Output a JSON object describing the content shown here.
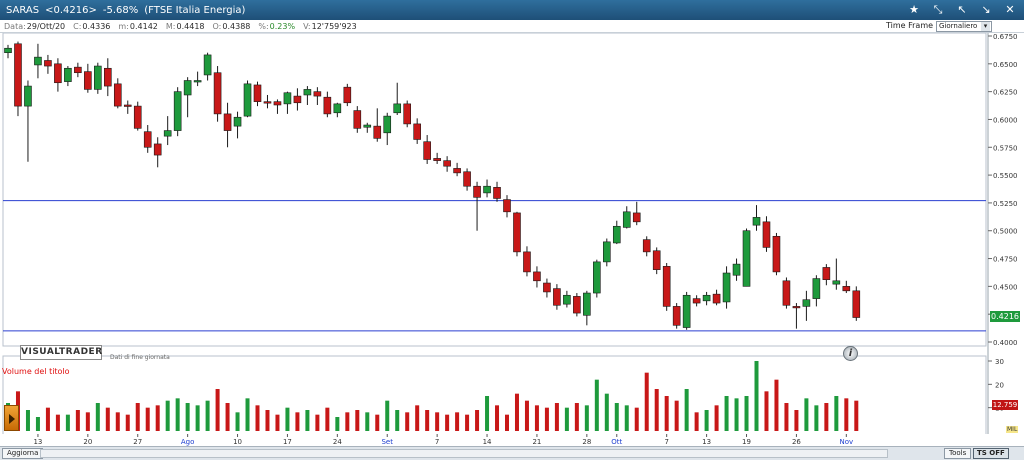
{
  "window": {
    "symbol": "SARAS",
    "price_change": "<0.4216>",
    "change_pct": "-5.68%",
    "index_name": "(FTSE Italia Energia)"
  },
  "infobar": {
    "date_label": "Data:",
    "date_value": "29/Ott/20",
    "close_label": "C:",
    "close_value": "0.4336",
    "min_label": "m:",
    "min_value": "0.4142",
    "max_label": "M:",
    "max_value": "0.4418",
    "open_label": "O:",
    "open_value": "0.4388",
    "pct_label": "%:",
    "pct_value": "0.23%",
    "volume_label": "V:",
    "volume_value": "12'759'923"
  },
  "timeframe": {
    "label": "Time Frame",
    "selected": "Giornaliero"
  },
  "logo": {
    "text": "VISUALTRADER",
    "note": "Dati di fine giornata"
  },
  "volume_panel": {
    "title": "Volume del titolo",
    "unit": "MIL",
    "badge": "12.759"
  },
  "last_price_badge": "0.4216",
  "bottom": {
    "refresh_label": "Aggiorna",
    "tools_label": "Tools",
    "tsoff_label": "TS OFF"
  },
  "colors": {
    "up": "#1e9a3c",
    "down": "#c81818",
    "hline": "#2a3fd0",
    "volume_up": "#1e9a3c",
    "volume_down": "#c81818"
  },
  "chart_data": {
    "type": "candlestick",
    "price_axis": {
      "min": 0.4,
      "max": 0.675,
      "ticks": [
        "0.6750",
        "0.6500",
        "0.6250",
        "0.6000",
        "0.5750",
        "0.5500",
        "0.5250",
        "0.5000",
        "0.4750",
        "0.4500",
        "0.4250",
        "0.4000"
      ]
    },
    "volume_axis": {
      "min": 0,
      "max": 30,
      "ticks": [
        "30",
        "20",
        "10"
      ]
    },
    "x_labels": [
      {
        "label": "13",
        "idx": 3
      },
      {
        "label": "20",
        "idx": 8
      },
      {
        "label": "27",
        "idx": 13
      },
      {
        "label": "Ago",
        "idx": 18,
        "month": true
      },
      {
        "label": "10",
        "idx": 23
      },
      {
        "label": "17",
        "idx": 28
      },
      {
        "label": "24",
        "idx": 33
      },
      {
        "label": "Set",
        "idx": 38,
        "month": true
      },
      {
        "label": "7",
        "idx": 43
      },
      {
        "label": "14",
        "idx": 48
      },
      {
        "label": "21",
        "idx": 53
      },
      {
        "label": "28",
        "idx": 58
      },
      {
        "label": "Ott",
        "idx": 61,
        "month": true
      },
      {
        "label": "7",
        "idx": 66
      },
      {
        "label": "13",
        "idx": 70
      },
      {
        "label": "19",
        "idx": 74
      },
      {
        "label": "26",
        "idx": 79
      },
      {
        "label": "Nov",
        "idx": 84,
        "month": true
      }
    ],
    "horizontal_lines": [
      0.527,
      0.41
    ],
    "candles": [
      {
        "o": 0.66,
        "h": 0.667,
        "l": 0.655,
        "c": 0.664,
        "v": 12
      },
      {
        "o": 0.668,
        "h": 0.67,
        "l": 0.603,
        "c": 0.612,
        "v": 17
      },
      {
        "o": 0.612,
        "h": 0.635,
        "l": 0.562,
        "c": 0.63,
        "v": 9
      },
      {
        "o": 0.649,
        "h": 0.668,
        "l": 0.637,
        "c": 0.656,
        "v": 6
      },
      {
        "o": 0.653,
        "h": 0.658,
        "l": 0.641,
        "c": 0.648,
        "v": 10
      },
      {
        "o": 0.65,
        "h": 0.655,
        "l": 0.625,
        "c": 0.633,
        "v": 7
      },
      {
        "o": 0.634,
        "h": 0.648,
        "l": 0.63,
        "c": 0.646,
        "v": 7
      },
      {
        "o": 0.647,
        "h": 0.651,
        "l": 0.638,
        "c": 0.642,
        "v": 9
      },
      {
        "o": 0.643,
        "h": 0.65,
        "l": 0.624,
        "c": 0.627,
        "v": 8
      },
      {
        "o": 0.627,
        "h": 0.651,
        "l": 0.623,
        "c": 0.648,
        "v": 12
      },
      {
        "o": 0.646,
        "h": 0.655,
        "l": 0.621,
        "c": 0.63,
        "v": 10
      },
      {
        "o": 0.632,
        "h": 0.637,
        "l": 0.61,
        "c": 0.612,
        "v": 8
      },
      {
        "o": 0.613,
        "h": 0.617,
        "l": 0.605,
        "c": 0.612,
        "v": 7
      },
      {
        "o": 0.612,
        "h": 0.616,
        "l": 0.59,
        "c": 0.592,
        "v": 12
      },
      {
        "o": 0.589,
        "h": 0.595,
        "l": 0.57,
        "c": 0.575,
        "v": 10
      },
      {
        "o": 0.578,
        "h": 0.584,
        "l": 0.557,
        "c": 0.568,
        "v": 11
      },
      {
        "o": 0.585,
        "h": 0.603,
        "l": 0.577,
        "c": 0.59,
        "v": 13
      },
      {
        "o": 0.59,
        "h": 0.629,
        "l": 0.585,
        "c": 0.625,
        "v": 14
      },
      {
        "o": 0.622,
        "h": 0.638,
        "l": 0.602,
        "c": 0.635,
        "v": 12
      },
      {
        "o": 0.634,
        "h": 0.643,
        "l": 0.63,
        "c": 0.635,
        "v": 11
      },
      {
        "o": 0.64,
        "h": 0.66,
        "l": 0.635,
        "c": 0.658,
        "v": 13
      },
      {
        "o": 0.642,
        "h": 0.648,
        "l": 0.598,
        "c": 0.605,
        "v": 18
      },
      {
        "o": 0.605,
        "h": 0.615,
        "l": 0.575,
        "c": 0.59,
        "v": 12
      },
      {
        "o": 0.594,
        "h": 0.607,
        "l": 0.583,
        "c": 0.602,
        "v": 8
      },
      {
        "o": 0.603,
        "h": 0.635,
        "l": 0.602,
        "c": 0.632,
        "v": 14
      },
      {
        "o": 0.631,
        "h": 0.634,
        "l": 0.612,
        "c": 0.616,
        "v": 11
      },
      {
        "o": 0.616,
        "h": 0.622,
        "l": 0.61,
        "c": 0.615,
        "v": 9
      },
      {
        "o": 0.616,
        "h": 0.618,
        "l": 0.605,
        "c": 0.613,
        "v": 7
      },
      {
        "o": 0.614,
        "h": 0.625,
        "l": 0.605,
        "c": 0.624,
        "v": 10
      },
      {
        "o": 0.621,
        "h": 0.628,
        "l": 0.608,
        "c": 0.615,
        "v": 8
      },
      {
        "o": 0.622,
        "h": 0.63,
        "l": 0.613,
        "c": 0.627,
        "v": 9
      },
      {
        "o": 0.625,
        "h": 0.629,
        "l": 0.613,
        "c": 0.621,
        "v": 7
      },
      {
        "o": 0.62,
        "h": 0.625,
        "l": 0.602,
        "c": 0.605,
        "v": 10
      },
      {
        "o": 0.606,
        "h": 0.615,
        "l": 0.602,
        "c": 0.614,
        "v": 6
      },
      {
        "o": 0.629,
        "h": 0.632,
        "l": 0.612,
        "c": 0.615,
        "v": 8
      },
      {
        "o": 0.608,
        "h": 0.612,
        "l": 0.588,
        "c": 0.592,
        "v": 9
      },
      {
        "o": 0.593,
        "h": 0.597,
        "l": 0.588,
        "c": 0.595,
        "v": 8
      },
      {
        "o": 0.594,
        "h": 0.61,
        "l": 0.58,
        "c": 0.583,
        "v": 7
      },
      {
        "o": 0.588,
        "h": 0.606,
        "l": 0.577,
        "c": 0.603,
        "v": 13
      },
      {
        "o": 0.606,
        "h": 0.633,
        "l": 0.604,
        "c": 0.614,
        "v": 9
      },
      {
        "o": 0.614,
        "h": 0.617,
        "l": 0.593,
        "c": 0.596,
        "v": 8
      },
      {
        "o": 0.596,
        "h": 0.601,
        "l": 0.578,
        "c": 0.582,
        "v": 11
      },
      {
        "o": 0.58,
        "h": 0.586,
        "l": 0.56,
        "c": 0.564,
        "v": 9
      },
      {
        "o": 0.565,
        "h": 0.57,
        "l": 0.56,
        "c": 0.563,
        "v": 8
      },
      {
        "o": 0.563,
        "h": 0.567,
        "l": 0.553,
        "c": 0.558,
        "v": 7
      },
      {
        "o": 0.556,
        "h": 0.561,
        "l": 0.549,
        "c": 0.552,
        "v": 8
      },
      {
        "o": 0.553,
        "h": 0.556,
        "l": 0.536,
        "c": 0.54,
        "v": 7
      },
      {
        "o": 0.54,
        "h": 0.544,
        "l": 0.5,
        "c": 0.53,
        "v": 9
      },
      {
        "o": 0.534,
        "h": 0.546,
        "l": 0.53,
        "c": 0.54,
        "v": 15
      },
      {
        "o": 0.539,
        "h": 0.544,
        "l": 0.526,
        "c": 0.529,
        "v": 11
      },
      {
        "o": 0.528,
        "h": 0.532,
        "l": 0.512,
        "c": 0.517,
        "v": 7
      },
      {
        "o": 0.516,
        "h": 0.517,
        "l": 0.477,
        "c": 0.481,
        "v": 16
      },
      {
        "o": 0.481,
        "h": 0.486,
        "l": 0.459,
        "c": 0.463,
        "v": 13
      },
      {
        "o": 0.463,
        "h": 0.468,
        "l": 0.449,
        "c": 0.455,
        "v": 11
      },
      {
        "o": 0.453,
        "h": 0.457,
        "l": 0.44,
        "c": 0.445,
        "v": 10
      },
      {
        "o": 0.448,
        "h": 0.452,
        "l": 0.429,
        "c": 0.433,
        "v": 12
      },
      {
        "o": 0.434,
        "h": 0.446,
        "l": 0.431,
        "c": 0.442,
        "v": 10
      },
      {
        "o": 0.441,
        "h": 0.444,
        "l": 0.423,
        "c": 0.426,
        "v": 12
      },
      {
        "o": 0.424,
        "h": 0.446,
        "l": 0.415,
        "c": 0.444,
        "v": 11
      },
      {
        "o": 0.444,
        "h": 0.474,
        "l": 0.44,
        "c": 0.472,
        "v": 22
      },
      {
        "o": 0.472,
        "h": 0.493,
        "l": 0.468,
        "c": 0.49,
        "v": 16
      },
      {
        "o": 0.489,
        "h": 0.509,
        "l": 0.488,
        "c": 0.504,
        "v": 12
      },
      {
        "o": 0.503,
        "h": 0.522,
        "l": 0.502,
        "c": 0.517,
        "v": 11
      },
      {
        "o": 0.516,
        "h": 0.526,
        "l": 0.505,
        "c": 0.508,
        "v": 10
      },
      {
        "o": 0.492,
        "h": 0.495,
        "l": 0.477,
        "c": 0.481,
        "v": 25
      },
      {
        "o": 0.482,
        "h": 0.485,
        "l": 0.461,
        "c": 0.465,
        "v": 18
      },
      {
        "o": 0.468,
        "h": 0.471,
        "l": 0.428,
        "c": 0.432,
        "v": 15
      },
      {
        "o": 0.432,
        "h": 0.435,
        "l": 0.412,
        "c": 0.415,
        "v": 13
      },
      {
        "o": 0.413,
        "h": 0.445,
        "l": 0.411,
        "c": 0.442,
        "v": 18
      },
      {
        "o": 0.439,
        "h": 0.442,
        "l": 0.432,
        "c": 0.435,
        "v": 8
      },
      {
        "o": 0.437,
        "h": 0.445,
        "l": 0.433,
        "c": 0.442,
        "v": 9
      },
      {
        "o": 0.443,
        "h": 0.447,
        "l": 0.433,
        "c": 0.435,
        "v": 11
      },
      {
        "o": 0.436,
        "h": 0.468,
        "l": 0.43,
        "c": 0.462,
        "v": 15
      },
      {
        "o": 0.46,
        "h": 0.475,
        "l": 0.455,
        "c": 0.47,
        "v": 14
      },
      {
        "o": 0.45,
        "h": 0.502,
        "l": 0.45,
        "c": 0.5,
        "v": 15
      },
      {
        "o": 0.505,
        "h": 0.523,
        "l": 0.5,
        "c": 0.512,
        "v": 30
      },
      {
        "o": 0.508,
        "h": 0.513,
        "l": 0.481,
        "c": 0.485,
        "v": 17
      },
      {
        "o": 0.495,
        "h": 0.498,
        "l": 0.46,
        "c": 0.463,
        "v": 22
      },
      {
        "o": 0.455,
        "h": 0.458,
        "l": 0.43,
        "c": 0.433,
        "v": 12
      },
      {
        "o": 0.432,
        "h": 0.435,
        "l": 0.412,
        "c": 0.431,
        "v": 9
      },
      {
        "o": 0.432,
        "h": 0.446,
        "l": 0.419,
        "c": 0.438,
        "v": 14
      },
      {
        "o": 0.439,
        "h": 0.46,
        "l": 0.432,
        "c": 0.457,
        "v": 11
      },
      {
        "o": 0.467,
        "h": 0.47,
        "l": 0.451,
        "c": 0.456,
        "v": 12
      },
      {
        "o": 0.452,
        "h": 0.475,
        "l": 0.447,
        "c": 0.455,
        "v": 15
      },
      {
        "o": 0.45,
        "h": 0.455,
        "l": 0.444,
        "c": 0.446,
        "v": 14
      },
      {
        "o": 0.446,
        "h": 0.45,
        "l": 0.419,
        "c": 0.422,
        "v": 13
      }
    ]
  }
}
